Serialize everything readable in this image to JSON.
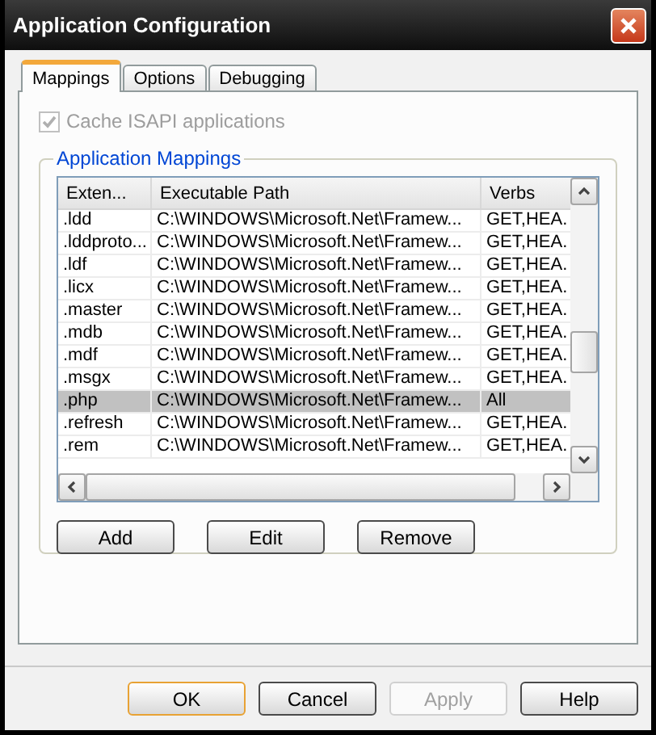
{
  "window": {
    "title": "Application Configuration"
  },
  "tabs": [
    {
      "label": "Mappings",
      "selected": true
    },
    {
      "label": "Options",
      "selected": false
    },
    {
      "label": "Debugging",
      "selected": false
    }
  ],
  "cache_checkbox": {
    "label": "Cache ISAPI applications",
    "checked": true,
    "disabled": true
  },
  "group": {
    "title": "Application Mappings"
  },
  "table": {
    "columns": [
      "Exten...",
      "Executable Path",
      "Verbs"
    ],
    "rows": [
      {
        "cells": [
          ".ldd",
          "C:\\WINDOWS\\Microsoft.Net\\Framew...",
          "GET,HEA."
        ],
        "selected": false
      },
      {
        "cells": [
          ".lddproto...",
          "C:\\WINDOWS\\Microsoft.Net\\Framew...",
          "GET,HEA."
        ],
        "selected": false
      },
      {
        "cells": [
          ".ldf",
          "C:\\WINDOWS\\Microsoft.Net\\Framew...",
          "GET,HEA."
        ],
        "selected": false
      },
      {
        "cells": [
          ".licx",
          "C:\\WINDOWS\\Microsoft.Net\\Framew...",
          "GET,HEA."
        ],
        "selected": false
      },
      {
        "cells": [
          ".master",
          "C:\\WINDOWS\\Microsoft.Net\\Framew...",
          "GET,HEA."
        ],
        "selected": false
      },
      {
        "cells": [
          ".mdb",
          "C:\\WINDOWS\\Microsoft.Net\\Framew...",
          "GET,HEA."
        ],
        "selected": false
      },
      {
        "cells": [
          ".mdf",
          "C:\\WINDOWS\\Microsoft.Net\\Framew...",
          "GET,HEA."
        ],
        "selected": false
      },
      {
        "cells": [
          ".msgx",
          "C:\\WINDOWS\\Microsoft.Net\\Framew...",
          "GET,HEA."
        ],
        "selected": false
      },
      {
        "cells": [
          ".php",
          "C:\\WINDOWS\\Microsoft.Net\\Framew...",
          "All"
        ],
        "selected": true
      },
      {
        "cells": [
          ".refresh",
          "C:\\WINDOWS\\Microsoft.Net\\Framew...",
          "GET,HEA."
        ],
        "selected": false
      },
      {
        "cells": [
          ".rem",
          "C:\\WINDOWS\\Microsoft.Net\\Framew...",
          "GET,HEA."
        ],
        "selected": false
      }
    ]
  },
  "list_buttons": [
    "Add",
    "Edit",
    "Remove"
  ],
  "dialog_buttons": [
    {
      "label": "OK",
      "default": true,
      "disabled": false
    },
    {
      "label": "Cancel",
      "default": false,
      "disabled": false
    },
    {
      "label": "Apply",
      "default": false,
      "disabled": true
    },
    {
      "label": "Help",
      "default": false,
      "disabled": false
    }
  ]
}
